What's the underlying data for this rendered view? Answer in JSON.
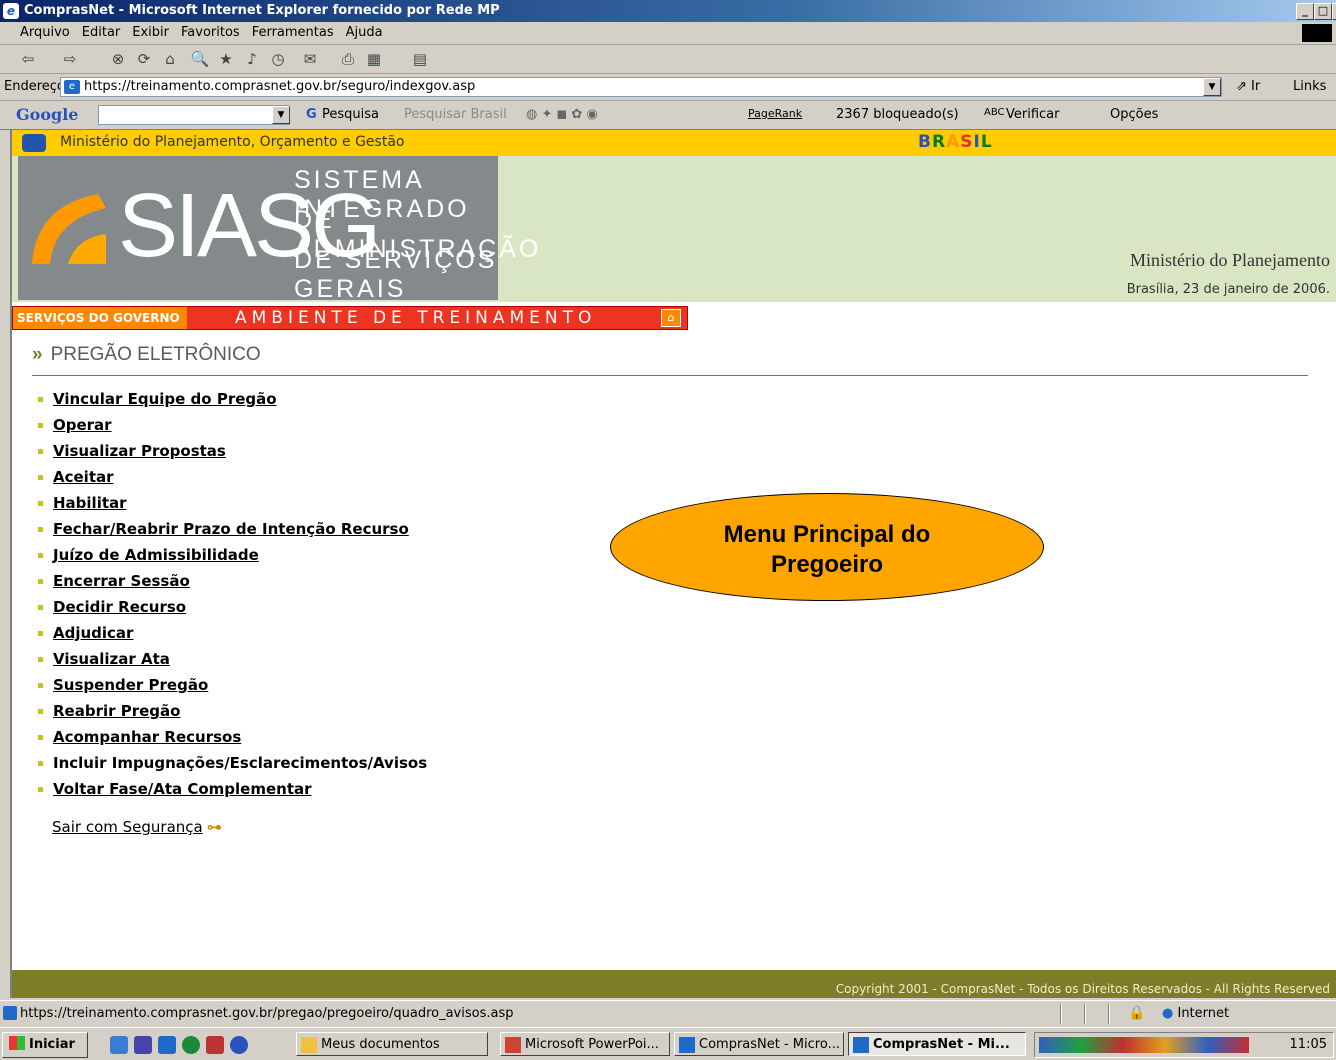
{
  "window": {
    "title": "ComprasNet - Microsoft Internet Explorer fornecido por Rede MP"
  },
  "menubar": [
    "Arquivo",
    "Editar",
    "Exibir",
    "Favoritos",
    "Ferramentas",
    "Ajuda"
  ],
  "address": {
    "label": "Endereço",
    "url": "https://treinamento.comprasnet.gov.br/seguro/indexgov.asp",
    "go_label": "Ir",
    "links_label": "Links"
  },
  "googlebar": {
    "logo": "Google",
    "search_label": "Pesquisa",
    "search_brasil_label": "Pesquisar Brasil",
    "pagerank_label": "PageRank",
    "blocked_label": "2367 bloqueado(s)",
    "check_label": "Verificar",
    "options_label": "Opções"
  },
  "site": {
    "ministry": "Ministério do Planejamento, Orçamento e Gestão",
    "brasil_logo": "BRASIL",
    "siasg_title": "SIASG",
    "siasg_lines": [
      "SISTEMA INTEGRADO",
      "DE ADMINISTRAÇÃO",
      "DE SERVIÇOS GERAIS"
    ],
    "ministerio_planejamento": "Ministério do Planejamento",
    "date": "Brasília, 23 de janeiro de 2006.",
    "servicos_label": "SERVIÇOS DO GOVERNO",
    "ambiente_label": "AMBIENTE DE TREINAMENTO",
    "section_title": "PREGÃO ELETRÔNICO",
    "menu_items": [
      "Vincular Equipe do Pregão",
      "Operar",
      "Visualizar Propostas",
      "Aceitar",
      "Habilitar",
      "Fechar/Reabrir Prazo de Intenção Recurso",
      "Juízo de Admissibilidade",
      "Encerrar Sessão",
      "Decidir Recurso",
      "Adjudicar",
      "Visualizar Ata",
      "Suspender Pregão",
      "Reabrir Pregão",
      "Acompanhar Recursos",
      "Incluir Impugnações/Esclarecimentos/Avisos",
      "Voltar Fase/Ata Complementar"
    ],
    "sair_label": "Sair com Segurança",
    "copyright": "Copyright 2001 - ComprasNet - Todos os Direitos Reservados - All Rights Reserved"
  },
  "callout": {
    "line1": "Menu Principal do",
    "line2": "Pregoeiro"
  },
  "statusbar": {
    "url": "https://treinamento.comprasnet.gov.br/pregao/pregoeiro/quadro_avisos.asp",
    "zone": "Internet"
  },
  "taskbar": {
    "start_label": "Iniciar",
    "tasks": [
      "Meus documentos",
      "Microsoft PowerPoi...",
      "ComprasNet - Micro...",
      "ComprasNet - Mi..."
    ],
    "clock": "11:05"
  }
}
